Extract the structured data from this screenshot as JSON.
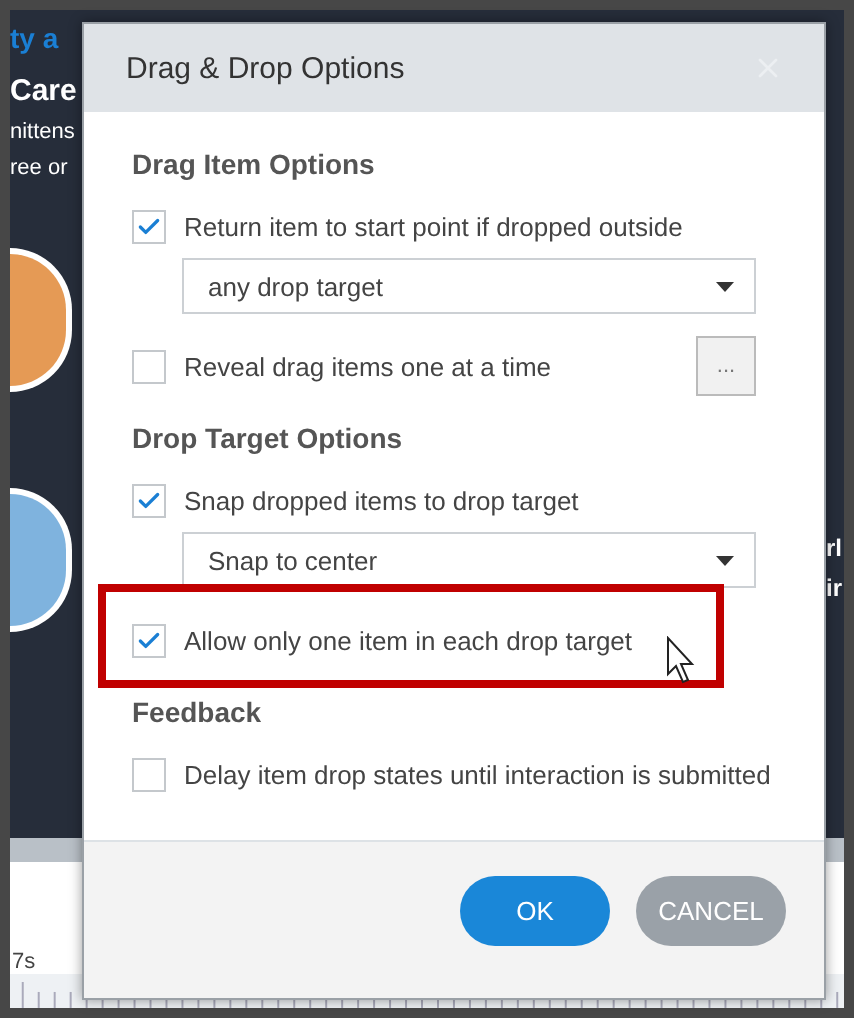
{
  "background": {
    "left_texts": [
      {
        "kind": "title",
        "text": "ty a"
      },
      {
        "kind": "heading",
        "text": "Care"
      },
      {
        "kind": "body",
        "text": "nittens"
      },
      {
        "kind": "body",
        "text": "ree or"
      }
    ],
    "right_texts": [
      "rl",
      "ir"
    ],
    "timeline_label": "7s"
  },
  "dialog": {
    "title": "Drag & Drop Options",
    "sections": [
      {
        "heading": "Drag Item Options",
        "items": [
          {
            "kind": "checkbox",
            "label": "Return item to start point if dropped outside",
            "checked": true,
            "highlighted": false
          },
          {
            "kind": "dropdown",
            "value": "any drop target"
          },
          {
            "kind": "checkbox",
            "label": "Reveal drag items one at a time",
            "checked": false,
            "highlighted": false,
            "more_button": "..."
          }
        ]
      },
      {
        "heading": "Drop Target Options",
        "items": [
          {
            "kind": "checkbox",
            "label": "Snap dropped items to drop target",
            "checked": true,
            "highlighted": false
          },
          {
            "kind": "dropdown",
            "value": "Snap to center"
          },
          {
            "kind": "checkbox",
            "label": "Allow only one item in each drop target",
            "checked": true,
            "highlighted": true
          }
        ]
      },
      {
        "heading": "Feedback",
        "items": [
          {
            "kind": "checkbox",
            "label": "Delay item drop states until interaction is submitted",
            "checked": false,
            "highlighted": false
          }
        ]
      }
    ],
    "buttons": [
      {
        "kind": "primary",
        "label": "OK"
      },
      {
        "kind": "secondary",
        "label": "CANCEL"
      }
    ]
  }
}
